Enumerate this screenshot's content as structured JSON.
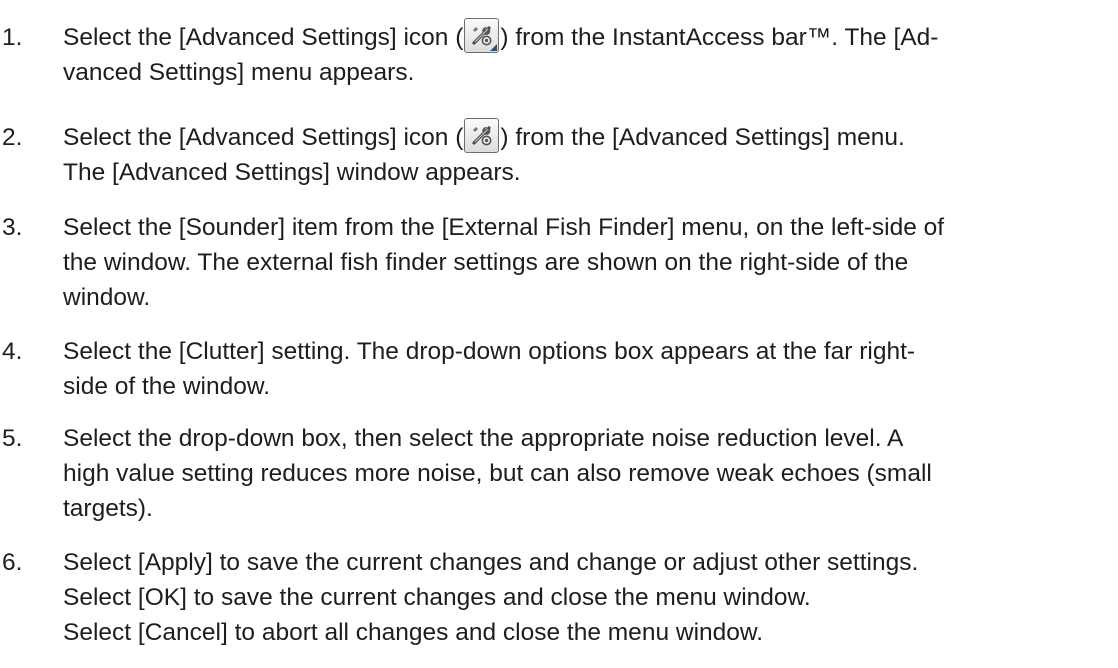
{
  "steps": [
    {
      "number": "1.",
      "lines": [
        {
          "before": "Select the [Advanced Settings] icon (",
          "after": ") from the InstantAccess bar™. The [Ad-"
        },
        {
          "text": "vanced Settings] menu appears."
        }
      ],
      "icon": "advanced-settings-icon"
    },
    {
      "number": "2.",
      "lines": [
        {
          "before": "Select the [Advanced Settings] icon (",
          "after": ") from the [Advanced Settings] menu."
        },
        {
          "text": "The [Advanced Settings] window appears."
        }
      ],
      "icon": "advanced-settings-icon"
    },
    {
      "number": "3.",
      "lines": [
        {
          "text": "Select the [Sounder] item from the [External Fish Finder] menu, on the left-side of"
        },
        {
          "text": "the window. The external fish finder settings are shown on the right-side of the"
        },
        {
          "text": "window."
        }
      ]
    },
    {
      "number": "4.",
      "lines": [
        {
          "text": "Select the [Clutter] setting. The drop-down options box appears at the far right-"
        },
        {
          "text": "side of the window."
        }
      ]
    },
    {
      "number": "5.",
      "lines": [
        {
          "text": "Select the drop-down box, then select the appropriate noise reduction level. A"
        },
        {
          "text": "high value setting reduces more noise, but can also remove weak echoes (small"
        },
        {
          "text": "targets)."
        }
      ]
    },
    {
      "number": "6.",
      "lines": [
        {
          "text": "Select [Apply] to save the current changes and change or adjust other settings."
        },
        {
          "text": "Select [OK] to save the current changes and close the menu window."
        },
        {
          "text": "Select [Cancel] to abort all changes and close the menu window."
        }
      ]
    }
  ]
}
